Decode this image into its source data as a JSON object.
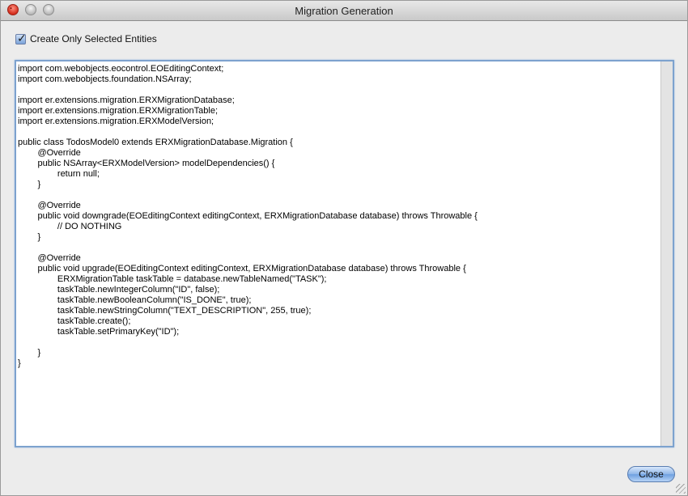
{
  "window": {
    "title": "Migration Generation"
  },
  "options": {
    "create_only_selected_label": "Create Only Selected Entities",
    "create_only_selected_checked": true
  },
  "code": {
    "text": "import com.webobjects.eocontrol.EOEditingContext;\nimport com.webobjects.foundation.NSArray;\n\nimport er.extensions.migration.ERXMigrationDatabase;\nimport er.extensions.migration.ERXMigrationTable;\nimport er.extensions.migration.ERXModelVersion;\n\npublic class TodosModel0 extends ERXMigrationDatabase.Migration {\n\t@Override\n\tpublic NSArray<ERXModelVersion> modelDependencies() {\n\t\treturn null;\n\t}\n\n\t@Override\n\tpublic void downgrade(EOEditingContext editingContext, ERXMigrationDatabase database) throws Throwable {\n\t\t// DO NOTHING\n\t}\n\n\t@Override\n\tpublic void upgrade(EOEditingContext editingContext, ERXMigrationDatabase database) throws Throwable {\n\t\tERXMigrationTable taskTable = database.newTableNamed(\"TASK\");\n\t\ttaskTable.newIntegerColumn(\"ID\", false);\n\t\ttaskTable.newBooleanColumn(\"IS_DONE\", true);\n\t\ttaskTable.newStringColumn(\"TEXT_DESCRIPTION\", 255, true);\n\t\ttaskTable.create();\n\t\ttaskTable.setPrimaryKey(\"ID\");\n\n\t}\n}"
  },
  "footer": {
    "close_label": "Close"
  },
  "colors": {
    "window_bg": "#ececec",
    "focus_ring": "#7da2ce",
    "close_light_red": "#d32d1c",
    "button_blue": "#6d9fe0"
  }
}
